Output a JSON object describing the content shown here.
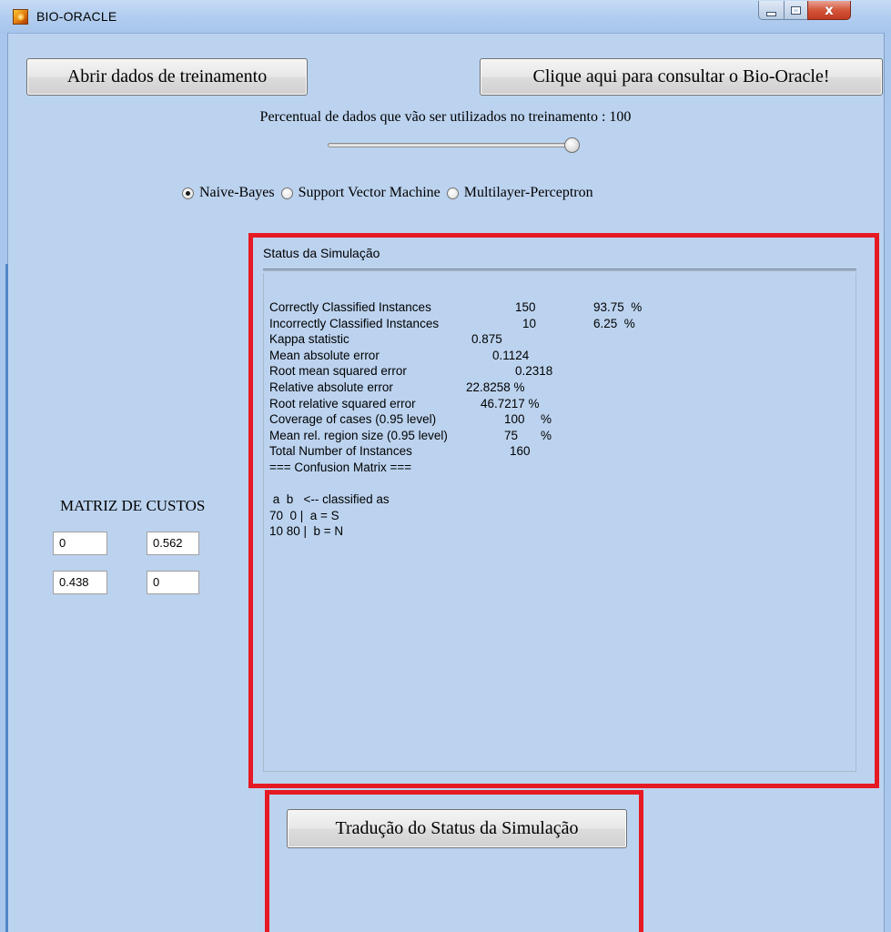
{
  "window": {
    "title": "BIO-ORACLE",
    "close_glyph": "x",
    "icons": [
      "app-icon",
      "minimize-icon",
      "maximize-icon",
      "close-icon"
    ]
  },
  "toolbar": {
    "open_training_label": "Abrir dados de treinamento",
    "consult_label": "Clique aqui para consultar o Bio-Oracle!"
  },
  "training": {
    "percent_label": "Percentual de dados que vão ser utilizados no treinamento : 100",
    "slider_value_percent": 100
  },
  "algorithms": {
    "selected": "Naive-Bayes",
    "options": [
      "Naive-Bayes",
      "Support Vector Machine",
      "Multilayer-Perceptron"
    ]
  },
  "status": {
    "title": "Status da Simulação",
    "lines": [
      [
        "Correctly Classified Instances",
        "150",
        "93.75  %"
      ],
      [
        "Incorrectly Classified Instances",
        "10",
        "6.25  %"
      ],
      [
        "Kappa statistic",
        "0.875"
      ],
      [
        "Mean absolute error",
        "0.1124"
      ],
      [
        "Root mean squared error",
        "0.2318"
      ],
      [
        "Relative absolute error",
        "22.8258 %"
      ],
      [
        "Root relative squared error",
        "46.7217 %"
      ],
      [
        "Coverage of cases (0.95 level)",
        "100",
        "%"
      ],
      [
        "Mean rel. region size (0.95 level)",
        "75",
        "%"
      ],
      [
        "Total Number of Instances",
        "160"
      ],
      [
        "=== Confusion Matrix ==="
      ],
      [
        ""
      ],
      [
        " a  b   <-- classified as"
      ],
      [
        "70  0 |  a = S"
      ],
      [
        "10 80 |  b = N"
      ]
    ]
  },
  "cost_matrix": {
    "title": "MATRIZ DE CUSTOS",
    "cells": [
      "0",
      "0.562",
      "0.438",
      "0"
    ]
  },
  "translate": {
    "label": "Tradução do Status da Simulação"
  },
  "colors": {
    "background": "#bcd3ef",
    "highlight": "#e51a23"
  }
}
